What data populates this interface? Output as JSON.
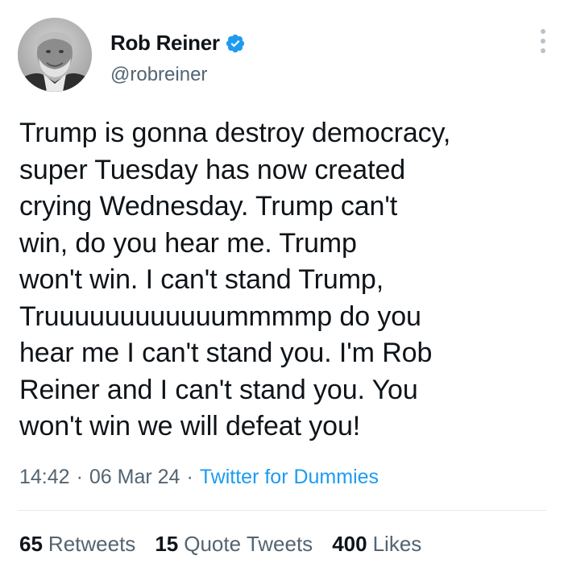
{
  "author": {
    "name": "Rob Reiner",
    "handle": "@robreiner",
    "verified": true,
    "verified_color": "#1d9bf0"
  },
  "tweet": {
    "text": "Trump is gonna destroy democracy,\nsuper Tuesday has now created\ncrying Wednesday. Trump can't\nwin, do you hear me. Trump\nwon't win. I can't stand Trump,\nTruuuuuuuuuuuummmmp do you\nhear me I can't stand you. I'm Rob\nReiner and I can't stand you. You\nwon't win we will defeat you!",
    "time": "14:42",
    "date": "06 Mar 24",
    "separator": "·",
    "source": "Twitter for Dummies"
  },
  "stats": {
    "retweets_count": "65",
    "retweets_label": "Retweets",
    "quotes_count": "15",
    "quotes_label": "Quote Tweets",
    "likes_count": "400",
    "likes_label": "Likes"
  },
  "icons": {
    "more": "more-vertical-icon",
    "verified": "verified-badge-icon"
  },
  "colors": {
    "link": "#1d9bf0",
    "secondary_text": "#536471",
    "primary_text": "#0f1419"
  }
}
